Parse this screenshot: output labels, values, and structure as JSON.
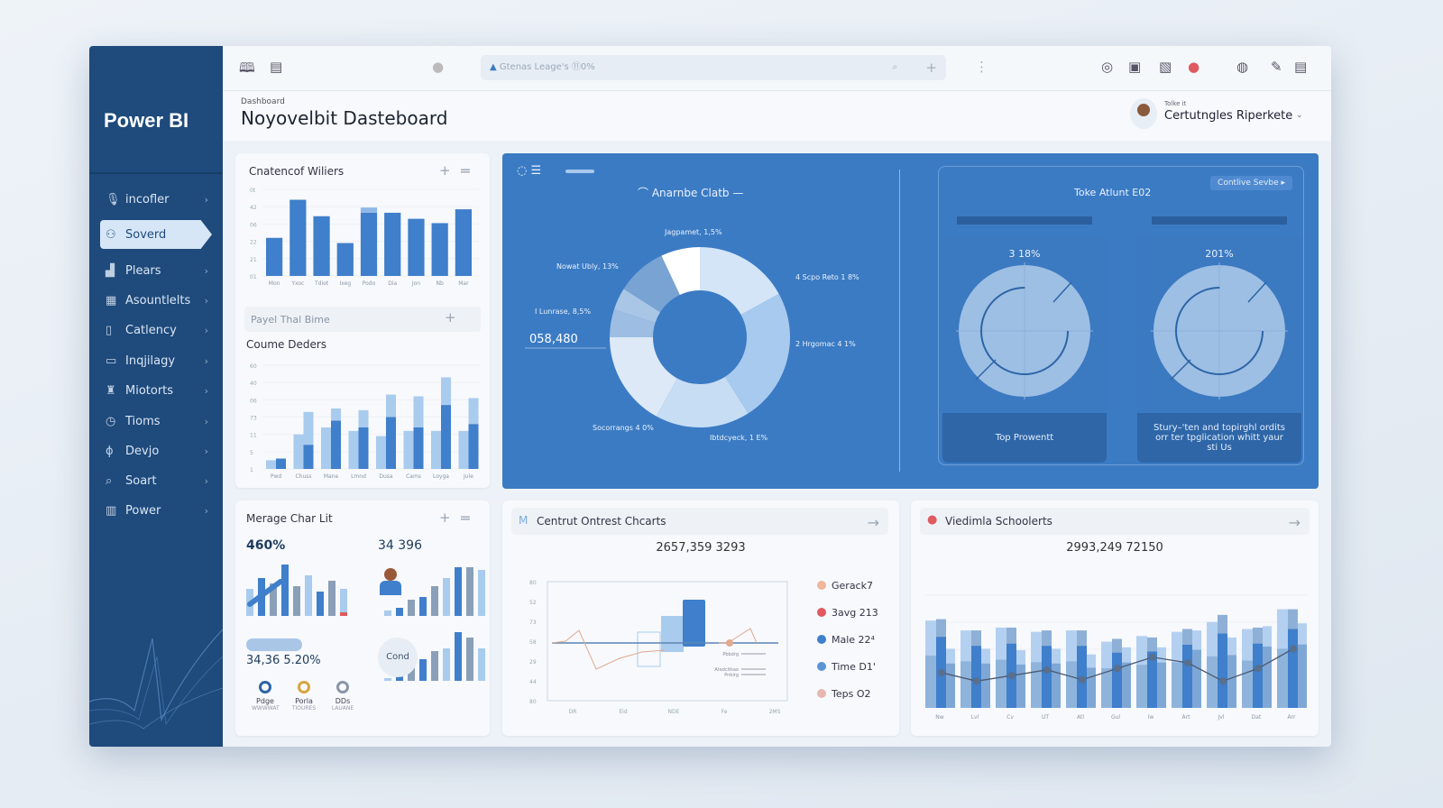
{
  "app": {
    "name": "Power BI",
    "breadcrumb": "Dashboard",
    "title": "Noyovelbit Dasteboard"
  },
  "search": {
    "placeholder": "Gtenas Leage's ⑪0%"
  },
  "user": {
    "role": "Tolke it",
    "name": "Certutngles Riperkete"
  },
  "sidebar": {
    "items": [
      {
        "label": "incofler",
        "icon": "microphone-icon",
        "glyph": "🎙"
      },
      {
        "label": "Soverd",
        "icon": "users-icon",
        "glyph": "⚇",
        "active": true
      },
      {
        "label": "Plears",
        "icon": "bar-chart-icon",
        "glyph": "▟"
      },
      {
        "label": "Asountlelts",
        "icon": "grid-icon",
        "glyph": "▦"
      },
      {
        "label": "Catlency",
        "icon": "document-icon",
        "glyph": "▯"
      },
      {
        "label": "Inqjilagy",
        "icon": "folder-icon",
        "glyph": "▭"
      },
      {
        "label": "Miotorts",
        "icon": "lamp-icon",
        "glyph": "♜"
      },
      {
        "label": "Tioms",
        "icon": "clock-icon",
        "glyph": "◷"
      },
      {
        "label": "Devjo",
        "icon": "pin-icon",
        "glyph": "ϕ"
      },
      {
        "label": "Soart",
        "icon": "search-icon",
        "glyph": "⌕"
      },
      {
        "label": "Power",
        "icon": "table-icon",
        "glyph": "▥"
      }
    ]
  },
  "card1": {
    "title": "Cnatencof Wiliers",
    "subpanel": "Payel Thal Bime",
    "title2": "Coume Deders"
  },
  "chart_data": [
    {
      "type": "bar",
      "title": "Cnatencof Wiliers",
      "categories": [
        "Mon",
        "Yxoc",
        "Tdiot",
        "Ixeg",
        "Podo",
        "Dia",
        "Jon",
        "Nb",
        "Mar"
      ],
      "values": [
        44,
        88,
        69,
        38,
        73,
        73,
        66,
        61,
        77
      ],
      "highlight": [
        0,
        0,
        0,
        0,
        6,
        0,
        0,
        0,
        0
      ],
      "ytick_labels": [
        "0t",
        "42",
        "06",
        "22",
        "21",
        "01"
      ],
      "ylim": [
        0,
        100
      ]
    },
    {
      "type": "bar",
      "title": "Coume Deders",
      "categories": [
        "Pwd",
        "Chuss",
        "Mane",
        "Lmnd",
        "Dusa",
        "Cams",
        "Loyga",
        "Jule"
      ],
      "series": [
        {
          "values": [
            5,
            20,
            24,
            22,
            19,
            22,
            22,
            22
          ]
        },
        {
          "values": [
            6,
            14,
            28,
            24,
            30,
            24,
            37,
            26
          ]
        },
        {
          "values": [
            0,
            19,
            7,
            10,
            13,
            18,
            16,
            15
          ]
        }
      ],
      "ytick_labels": [
        "60",
        "40",
        "06",
        "73",
        "11",
        "5",
        "1"
      ],
      "ylim": [
        0,
        60
      ]
    },
    {
      "type": "pie",
      "title": "Anarnbe Clatb",
      "slices": [
        {
          "label": "4 Scpo Reto 1 8%",
          "value": 17,
          "color": "#d3e5f7"
        },
        {
          "label": "2 Hrgomac 4 1%",
          "value": 24,
          "color": "#a8caee"
        },
        {
          "label": "Ibtdcyeck, 1 E%",
          "value": 17,
          "color": "#c6ddf4"
        },
        {
          "label": "Socorrangs 4 0%",
          "value": 17,
          "color": "#dde9f7"
        },
        {
          "label": "",
          "value": 5,
          "color": "#9dbde2"
        },
        {
          "label": "I Lunrase, 8,5%",
          "value": 4,
          "color": "#a9c6e7"
        },
        {
          "label": "Nowat Ubly, 13%",
          "value": 9,
          "color": "#78a3d2"
        },
        {
          "label": "Jagpamet, 1,5%",
          "value": 7,
          "color": "#ffffff"
        }
      ],
      "center_callout": "058,480"
    },
    {
      "type": "line",
      "title": "Centrut Ontrest Chcarts",
      "total": "2657,359 3293",
      "x": [
        "DR",
        "Eid",
        "NDE",
        "Fe",
        "2MS"
      ],
      "ytick_labels": [
        "80",
        "52",
        "73",
        "58",
        "29",
        "44",
        "80"
      ],
      "legend": [
        "Gerack7",
        "3avg 213",
        "Male 22⁴",
        "Time D1'",
        "Teps O2"
      ],
      "notes": [
        "Pbbdrg",
        "Atedcitkao",
        "Pnbirg"
      ]
    },
    {
      "type": "bar",
      "title": "Viedimla Schoolerts",
      "total": "2993,249 72150",
      "categories": [
        "Nw",
        "Lvl",
        "Cv",
        "UT",
        "Atl",
        "Gul",
        "Iw",
        "Art",
        "Jvl",
        "Dat",
        "Arr"
      ],
      "series": [
        {
          "values": [
            62,
            55,
            57,
            54,
            55,
            47,
            51,
            54,
            61,
            56,
            70
          ]
        },
        {
          "values": [
            63,
            55,
            57,
            55,
            55,
            49,
            50,
            56,
            66,
            57,
            70
          ]
        },
        {
          "values": [
            42,
            42,
            41,
            42,
            38,
            43,
            43,
            55,
            50,
            58,
            60
          ]
        }
      ],
      "line": [
        25,
        19,
        23,
        27,
        20,
        28,
        36,
        32,
        19,
        28,
        42
      ],
      "ylim": [
        0,
        80
      ]
    }
  ],
  "gauges": {
    "title": "Toke Atlunt E02",
    "button": "Contlive Sevbe",
    "items": [
      {
        "value_label": "3 18%",
        "value": 0.75,
        "caption": "Top Prowentt"
      },
      {
        "value_label": "201%",
        "value": 0.75,
        "caption": "Stury–'ten and topirghl ordits orr ter tpglication whitt yaur sti Us"
      }
    ]
  },
  "merage": {
    "title": "Merage Char Lit",
    "kpi1": "460%",
    "kpi2": "34 396",
    "kpi3": "34,36 5.20%",
    "badge": "Cond",
    "legend": [
      {
        "label": "Pdge",
        "sub": "WWWWAT",
        "color": "#2d64a6"
      },
      {
        "label": "Porla",
        "sub": "TIOURES",
        "color": "#d9a441"
      },
      {
        "label": "DDs",
        "sub": "LAUANE",
        "color": "#8a96a6"
      }
    ]
  },
  "colors": {
    "sidebar": "#1e4a7c",
    "accent": "#3b7bc4",
    "bar": "#3f7fcb",
    "alert": "#e05a5f"
  }
}
